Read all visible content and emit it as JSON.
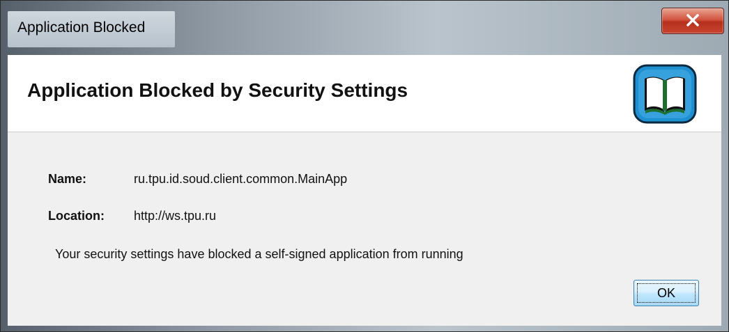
{
  "window": {
    "title": "Application Blocked"
  },
  "header": {
    "title": "Application Blocked by Security Settings",
    "icon": "java-book-icon"
  },
  "details": {
    "name_label": "Name:",
    "name_value": "ru.tpu.id.soud.client.common.MainApp",
    "location_label": "Location:",
    "location_value": "http://ws.tpu.ru"
  },
  "message": "Your security settings have blocked a self-signed application from running",
  "buttons": {
    "ok_label": "OK",
    "close_icon": "close-icon"
  },
  "colors": {
    "close_button": "#c94530",
    "icon_blue": "#1e8fd1",
    "content_background": "#f0f0f0"
  }
}
